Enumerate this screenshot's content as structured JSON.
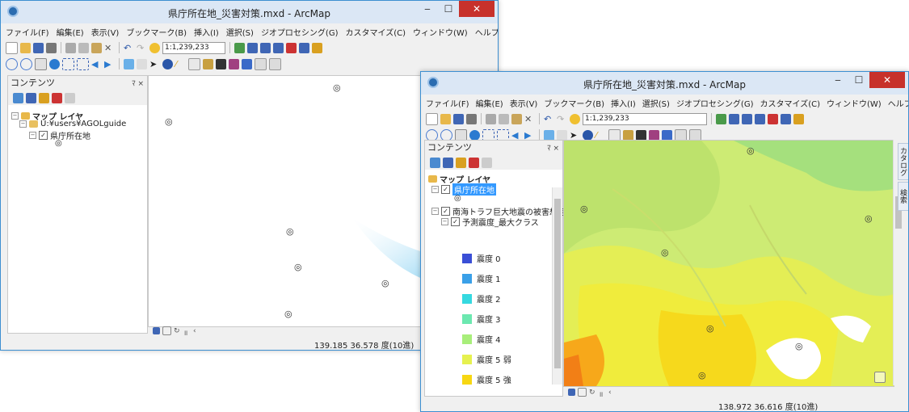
{
  "app_icon": "arcmap-globe-icon",
  "window_back": {
    "title": "県庁所在地_災害対策.mxd - ArcMap",
    "menu": [
      "ファイル(F)",
      "編集(E)",
      "表示(V)",
      "ブックマーク(B)",
      "挿入(I)",
      "選択(S)",
      "ジオプロセシング(G)",
      "カスタマイズ(C)",
      "ウィンドウ(W)",
      "ヘルプ(H)"
    ],
    "scale": "1:1,239,233",
    "toc": {
      "title": "コンテンツ",
      "pin": "ﾏ ×",
      "root": "マップ レイヤ",
      "folder": "U:¥users¥AGOLguide",
      "layer": "県庁所在地",
      "symbol": "◎"
    },
    "status": "139.185  36.578 度(10進)"
  },
  "window_front": {
    "title": "県庁所在地_災害対策.mxd - ArcMap",
    "menu": [
      "ファイル(F)",
      "編集(E)",
      "表示(V)",
      "ブックマーク(B)",
      "挿入(I)",
      "選択(S)",
      "ジオプロセシング(G)",
      "カスタマイズ(C)",
      "ウィンドウ(W)",
      "ヘルプ(H)"
    ],
    "scale": "1:1,239,233",
    "toc": {
      "title": "コンテンツ",
      "pin": "ﾏ ×",
      "root": "マップ レイヤ",
      "layer_selected": "県庁所在地",
      "symbol": "◎",
      "group": "南海トラフ巨大地震の被害想定",
      "sublayer": "予測震度_最大クラス"
    },
    "legend": [
      {
        "label": "震度 0",
        "color": "#3a4fd6"
      },
      {
        "label": "震度 1",
        "color": "#3aa0e8"
      },
      {
        "label": "震度 2",
        "color": "#35d9e0"
      },
      {
        "label": "震度 3",
        "color": "#6ce8b0"
      },
      {
        "label": "震度 4",
        "color": "#a8ee7a"
      },
      {
        "label": "震度 5 弱",
        "color": "#e6f14f"
      },
      {
        "label": "震度 5 強",
        "color": "#f7d712"
      }
    ],
    "side_tabs": [
      "カタログ",
      "検索"
    ],
    "status": "138.972  36.616 度(10進)"
  },
  "map_marker": "◎"
}
